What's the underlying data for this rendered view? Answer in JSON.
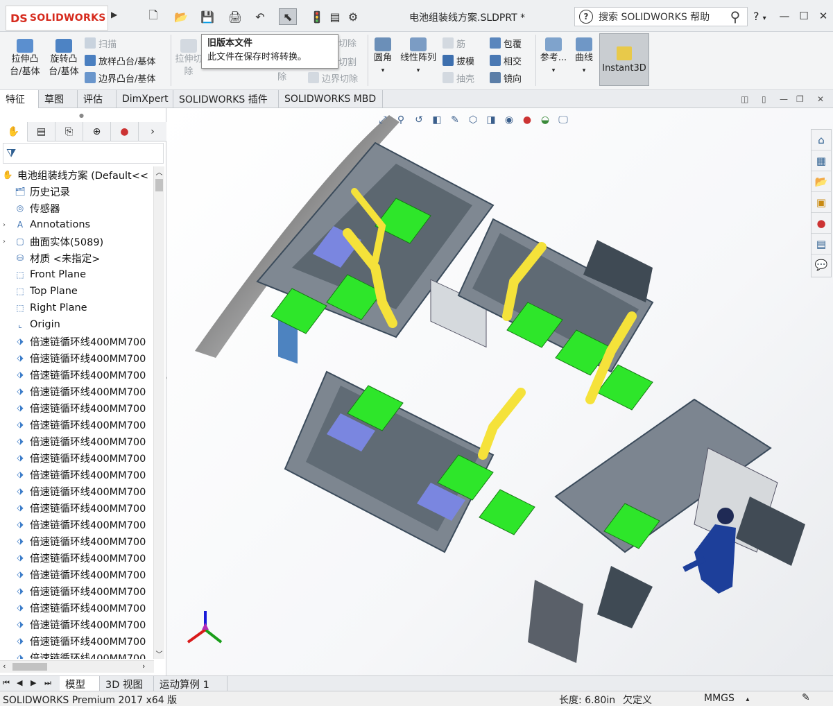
{
  "app": {
    "brand": "SOLIDWORKS",
    "logo_mark": "DS",
    "doc_title": "电池组装线方案.SLDPRT *",
    "search_placeholder": "搜索 SOLIDWORKS 帮助",
    "help": "?",
    "help_arrow": "▾"
  },
  "quick_access": [
    {
      "icon": "new-document-icon",
      "glyph": "🗋"
    },
    {
      "icon": "open-folder-icon",
      "glyph": "📂"
    },
    {
      "icon": "save-icon",
      "glyph": "💾"
    },
    {
      "icon": "print-icon",
      "glyph": "🖨"
    },
    {
      "icon": "undo-icon",
      "glyph": "↶"
    },
    {
      "icon": "select-pointer-icon",
      "glyph": "⬉"
    },
    {
      "icon": "rebuild-traffic-light-icon",
      "glyph": "🚦"
    },
    {
      "icon": "file-properties-icon",
      "glyph": "▤"
    },
    {
      "icon": "options-gear-icon",
      "glyph": "⚙"
    }
  ],
  "ribbon": {
    "extrude_boss": "拉伸凸\n台/基体",
    "revolve_boss": "旋转凸\n台/基体",
    "sweep": "扫描",
    "loft_boss": "放样凸台/基体",
    "boundary_boss": "边界凸台/基体",
    "extrude_cut": "拉伸切\n除",
    "cut_fragment_1": "切除",
    "cut_fragment_2": "切割",
    "cut_fragment_3": "除",
    "boundary_cut": "边界切除",
    "fillet": "圆角",
    "linear_pattern": "线性阵列",
    "rib": "筋",
    "draft": "拔模",
    "shell": "抽壳",
    "wrap": "包覆",
    "intersect": "相交",
    "mirror": "镜向",
    "reference": "参考...",
    "curves": "曲线",
    "instant3d": "Instant3D"
  },
  "tooltip": {
    "title": "旧版本文件",
    "body": "此文件在保存时将转换。"
  },
  "tabs": [
    "特征",
    "草图",
    "评估",
    "DimXpert",
    "SOLIDWORKS 插件",
    "SOLIDWORKS MBD"
  ],
  "tree": {
    "root": "电池组装线方案  (Default<<",
    "items": [
      {
        "label": "历史记录",
        "icon": "history-folder-icon",
        "expand": ""
      },
      {
        "label": "传感器",
        "icon": "sensor-icon",
        "expand": ""
      },
      {
        "label": "Annotations",
        "icon": "annotations-icon",
        "expand": "›"
      },
      {
        "label": "曲面实体(5089)",
        "icon": "surface-bodies-icon",
        "expand": "›"
      },
      {
        "label": "材质 <未指定>",
        "icon": "material-icon",
        "expand": ""
      },
      {
        "label": "Front Plane",
        "icon": "plane-icon",
        "expand": ""
      },
      {
        "label": "Top Plane",
        "icon": "plane-icon",
        "expand": ""
      },
      {
        "label": "Right Plane",
        "icon": "plane-icon",
        "expand": ""
      },
      {
        "label": "Origin",
        "icon": "origin-icon",
        "expand": ""
      }
    ],
    "feature_label": "倍速链循环线400MM700",
    "feature_count": 20
  },
  "bottom_tabs": [
    "模型",
    "3D 视图",
    "运动算例 1"
  ],
  "status": {
    "product": "SOLIDWORKS Premium 2017 x64 版",
    "length": "长度: 6.80in",
    "under_defined": "欠定义",
    "units": "MMGS",
    "units_arrow": "▴"
  },
  "colors": {
    "brand": "#d62a1d",
    "robot": "#f5e23a",
    "fixture": "#2ee62a",
    "frame": "#5a8fc7"
  }
}
